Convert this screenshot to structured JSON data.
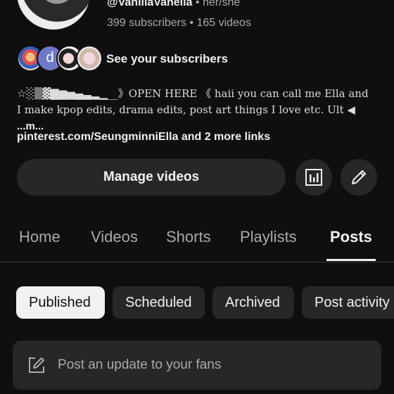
{
  "channel": {
    "handle": "@VanillaVanella",
    "pronouns": " • her/she",
    "stats": "399 subscribers • 165 videos",
    "subscriber_initial": "d",
    "see_subscribers": "See your subscribers",
    "description": "☆░▒▓▇▆▅▄▃▂▁__》OPEN HERE 《 haii you can call me Ella and I make kpop edits, drama edits, post art things I love etc. Ult ◀ ",
    "description_more": "...m...",
    "link": "pinterest.com/SeungminniElla",
    "more_links": " and 2 more links"
  },
  "actions": {
    "manage_videos": "Manage videos"
  },
  "tabs": [
    {
      "label": "Home"
    },
    {
      "label": "Videos"
    },
    {
      "label": "Shorts"
    },
    {
      "label": "Playlists"
    },
    {
      "label": "Posts"
    }
  ],
  "active_tab": "Posts",
  "filters": [
    {
      "label": "Published"
    },
    {
      "label": "Scheduled"
    },
    {
      "label": "Archived"
    },
    {
      "label": "Post activity"
    }
  ],
  "selected_filter": "Published",
  "composer": {
    "placeholder": "Post an update to your fans"
  }
}
